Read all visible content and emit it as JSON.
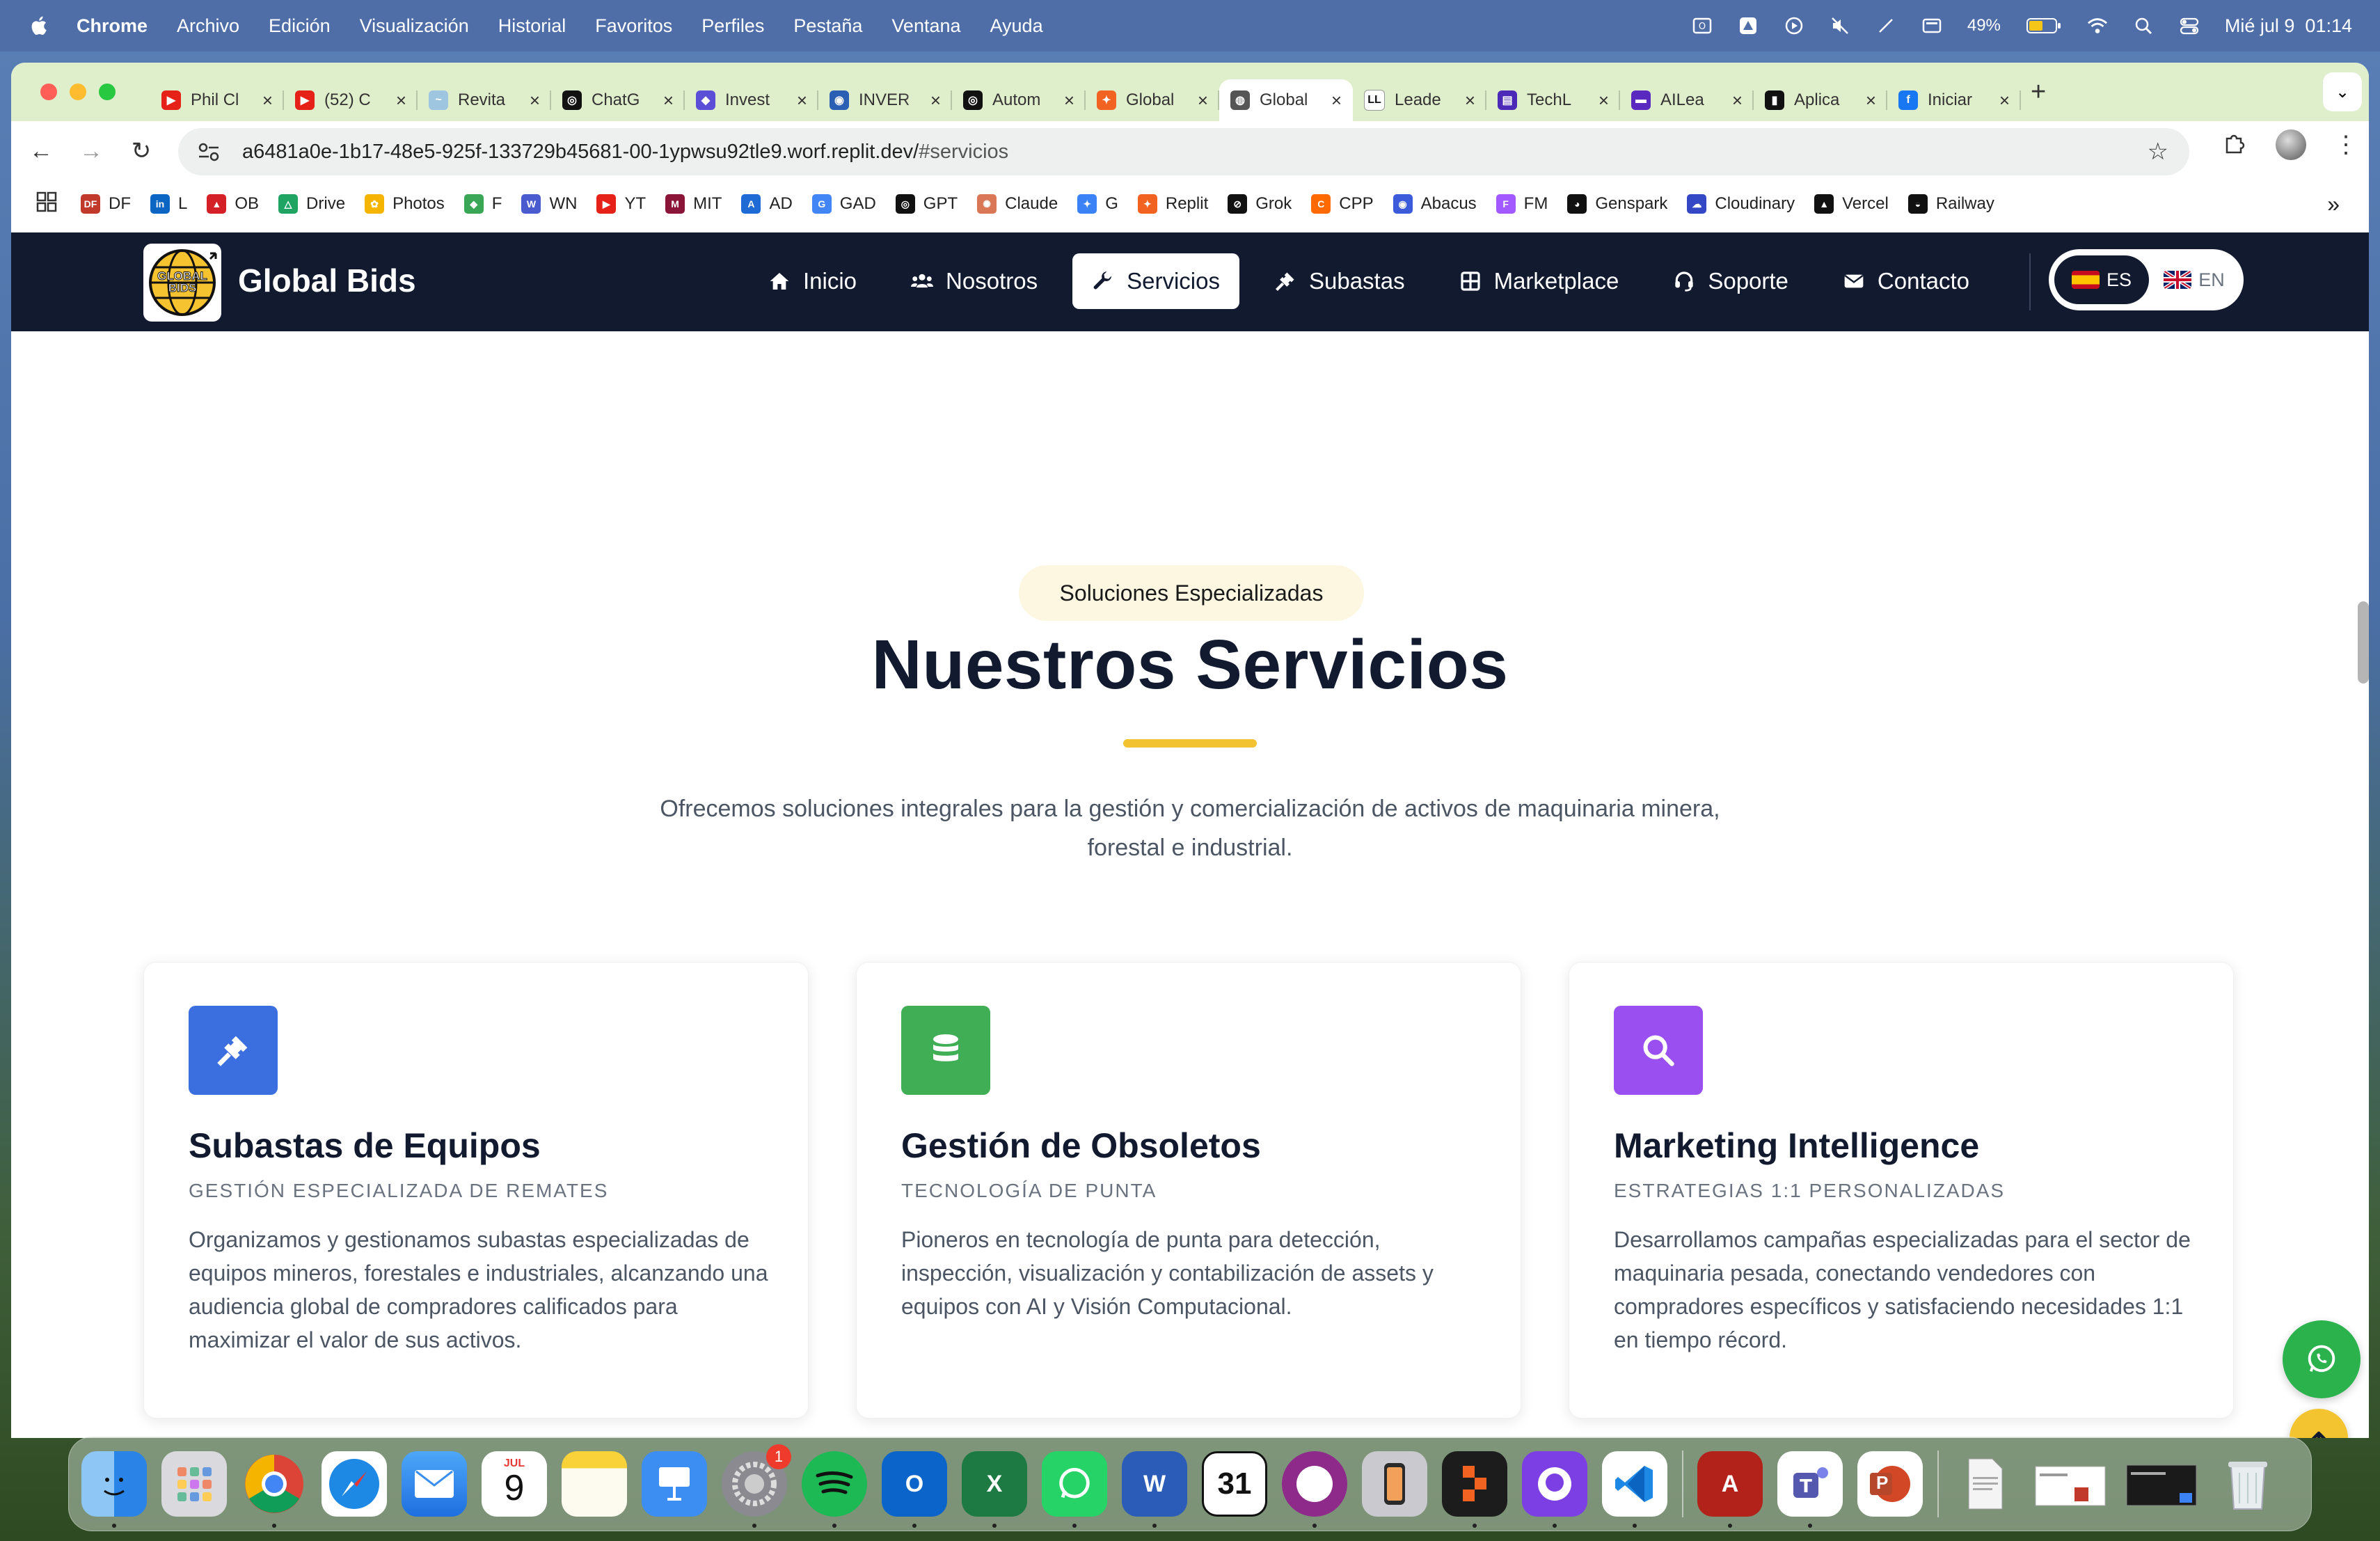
{
  "menubar": {
    "items": [
      "Chrome",
      "Archivo",
      "Edición",
      "Visualización",
      "Historial",
      "Favoritos",
      "Perfiles",
      "Pestaña",
      "Ventana",
      "Ayuda"
    ],
    "battery": "49%",
    "datetime": "Mié jul 9  01:14"
  },
  "tabs": [
    {
      "label": "Phil Cl",
      "color": "#e62117",
      "glyph": "▶"
    },
    {
      "label": "(52) C",
      "color": "#e62117",
      "glyph": "▶"
    },
    {
      "label": "Revita",
      "color": "#9fc6e0",
      "glyph": "~"
    },
    {
      "label": "ChatG",
      "color": "#111111",
      "glyph": "◎"
    },
    {
      "label": "Invest",
      "color": "#5b4fd8",
      "glyph": "◆"
    },
    {
      "label": "INVER",
      "color": "#2b5fb3",
      "glyph": "◉"
    },
    {
      "label": "Autom",
      "color": "#111111",
      "glyph": "◎"
    },
    {
      "label": "Global",
      "color": "#f26322",
      "glyph": "✦"
    },
    {
      "label": "Global",
      "color": "#555555",
      "glyph": "◍"
    },
    {
      "label": "Leade",
      "color": "#ffffff",
      "glyph": "LL"
    },
    {
      "label": "TechL",
      "color": "#4b2ab8",
      "glyph": "▤"
    },
    {
      "label": "AILea",
      "color": "#5a2ac0",
      "glyph": "▬"
    },
    {
      "label": "Aplica",
      "color": "#111111",
      "glyph": "▮"
    },
    {
      "label": "Iniciar",
      "color": "#1877f2",
      "glyph": "f"
    }
  ],
  "omnibox": {
    "url_host": "a6481a0e-1b17-48e5-925f-133729b45681-00-1ypwsu92tle9.worf.replit.dev/",
    "url_path": "#servicios"
  },
  "bookmarks": [
    {
      "label": "DF",
      "color": "#c0392b",
      "glyph": "DF"
    },
    {
      "label": "L",
      "color": "#0a66c2",
      "glyph": "in"
    },
    {
      "label": "OB",
      "color": "#d42027",
      "glyph": "▲"
    },
    {
      "label": "Drive",
      "color": "#1fa463",
      "glyph": "△"
    },
    {
      "label": "Photos",
      "color": "#f4b400",
      "glyph": "✿"
    },
    {
      "label": "F",
      "color": "#3aa757",
      "glyph": "◆"
    },
    {
      "label": "WN",
      "color": "#4a5bd0",
      "glyph": "W"
    },
    {
      "label": "YT",
      "color": "#e62117",
      "glyph": "▶"
    },
    {
      "label": "MIT",
      "color": "#8a1538",
      "glyph": "M"
    },
    {
      "label": "AD",
      "color": "#1e6bd6",
      "glyph": "A"
    },
    {
      "label": "GAD",
      "color": "#4285f4",
      "glyph": "G"
    },
    {
      "label": "GPT",
      "color": "#111111",
      "glyph": "◎"
    },
    {
      "label": "Claude",
      "color": "#d97757",
      "glyph": "✺"
    },
    {
      "label": "G",
      "color": "#3b82f6",
      "glyph": "✦"
    },
    {
      "label": "Replit",
      "color": "#f26322",
      "glyph": "✦"
    },
    {
      "label": "Grok",
      "color": "#111111",
      "glyph": "⊘"
    },
    {
      "label": "CPP",
      "color": "#ff6a00",
      "glyph": "C"
    },
    {
      "label": "Abacus",
      "color": "#3b5bdb",
      "glyph": "◉"
    },
    {
      "label": "FM",
      "color": "#a259ff",
      "glyph": "F"
    },
    {
      "label": "Genspark",
      "color": "#111111",
      "glyph": "◕"
    },
    {
      "label": "Cloudinary",
      "color": "#3448c5",
      "glyph": "☁"
    },
    {
      "label": "Vercel",
      "color": "#111111",
      "glyph": "▲"
    },
    {
      "label": "Railway",
      "color": "#111111",
      "glyph": "◒"
    }
  ],
  "site": {
    "brand": "Global Bids",
    "logo_text": "GLOBAL BIDS",
    "nav": [
      {
        "label": "Inicio",
        "icon": "home-icon",
        "active": false
      },
      {
        "label": "Nosotros",
        "icon": "users-icon",
        "active": false
      },
      {
        "label": "Servicios",
        "icon": "wrench-icon",
        "active": true
      },
      {
        "label": "Subastas",
        "icon": "gavel-icon",
        "active": false
      },
      {
        "label": "Marketplace",
        "icon": "grid-icon",
        "active": false
      },
      {
        "label": "Soporte",
        "icon": "headset-icon",
        "active": false
      },
      {
        "label": "Contacto",
        "icon": "envelope-icon",
        "active": false
      }
    ],
    "lang_es": "ES",
    "lang_en": "EN",
    "section": {
      "pill": "Soluciones Especializadas",
      "title": "Nuestros Servicios",
      "lead": "Ofrecemos soluciones integrales para la gestión y comercialización de activos de maquinaria minera, forestal e industrial."
    },
    "cards": [
      {
        "title": "Subastas de Equipos",
        "subtitle": "GESTIÓN ESPECIALIZADA DE REMATES",
        "desc": "Organizamos y gestionamos subastas especializadas de equipos mineros, forestales e industriales, alcanzando una audiencia global de compradores calificados para maximizar el valor de sus activos.",
        "icon_color": "#3b6fe0",
        "icon": "gavel-icon"
      },
      {
        "title": "Gestión de Obsoletos",
        "subtitle": "TECNOLOGÍA DE PUNTA",
        "desc": "Pioneros en tecnología de punta para detección, inspección, visualización y contabilización de assets y equipos con AI y Visión Computacional.",
        "icon_color": "#3fae55",
        "icon": "database-icon"
      },
      {
        "title": "Marketing Intelligence",
        "subtitle": "ESTRATEGIAS 1:1 PERSONALIZADAS",
        "desc": "Desarrollamos campañas especializadas para el sector de maquinaria pesada, conectando vendedores con compradores específicos y satisfaciendo necesidades 1:1 en tiempo récord.",
        "icon_color": "#9a4ff0",
        "icon": "search-icon"
      }
    ]
  },
  "dock": {
    "calendar_month": "JUL",
    "calendar_day": "9",
    "settings_badge": "1",
    "outlook_letter": "O",
    "excel_letter": "X",
    "word_letter": "W",
    "date_app_day": "31",
    "acrobat_glyph": "A",
    "powerpoint_letter": "P"
  }
}
